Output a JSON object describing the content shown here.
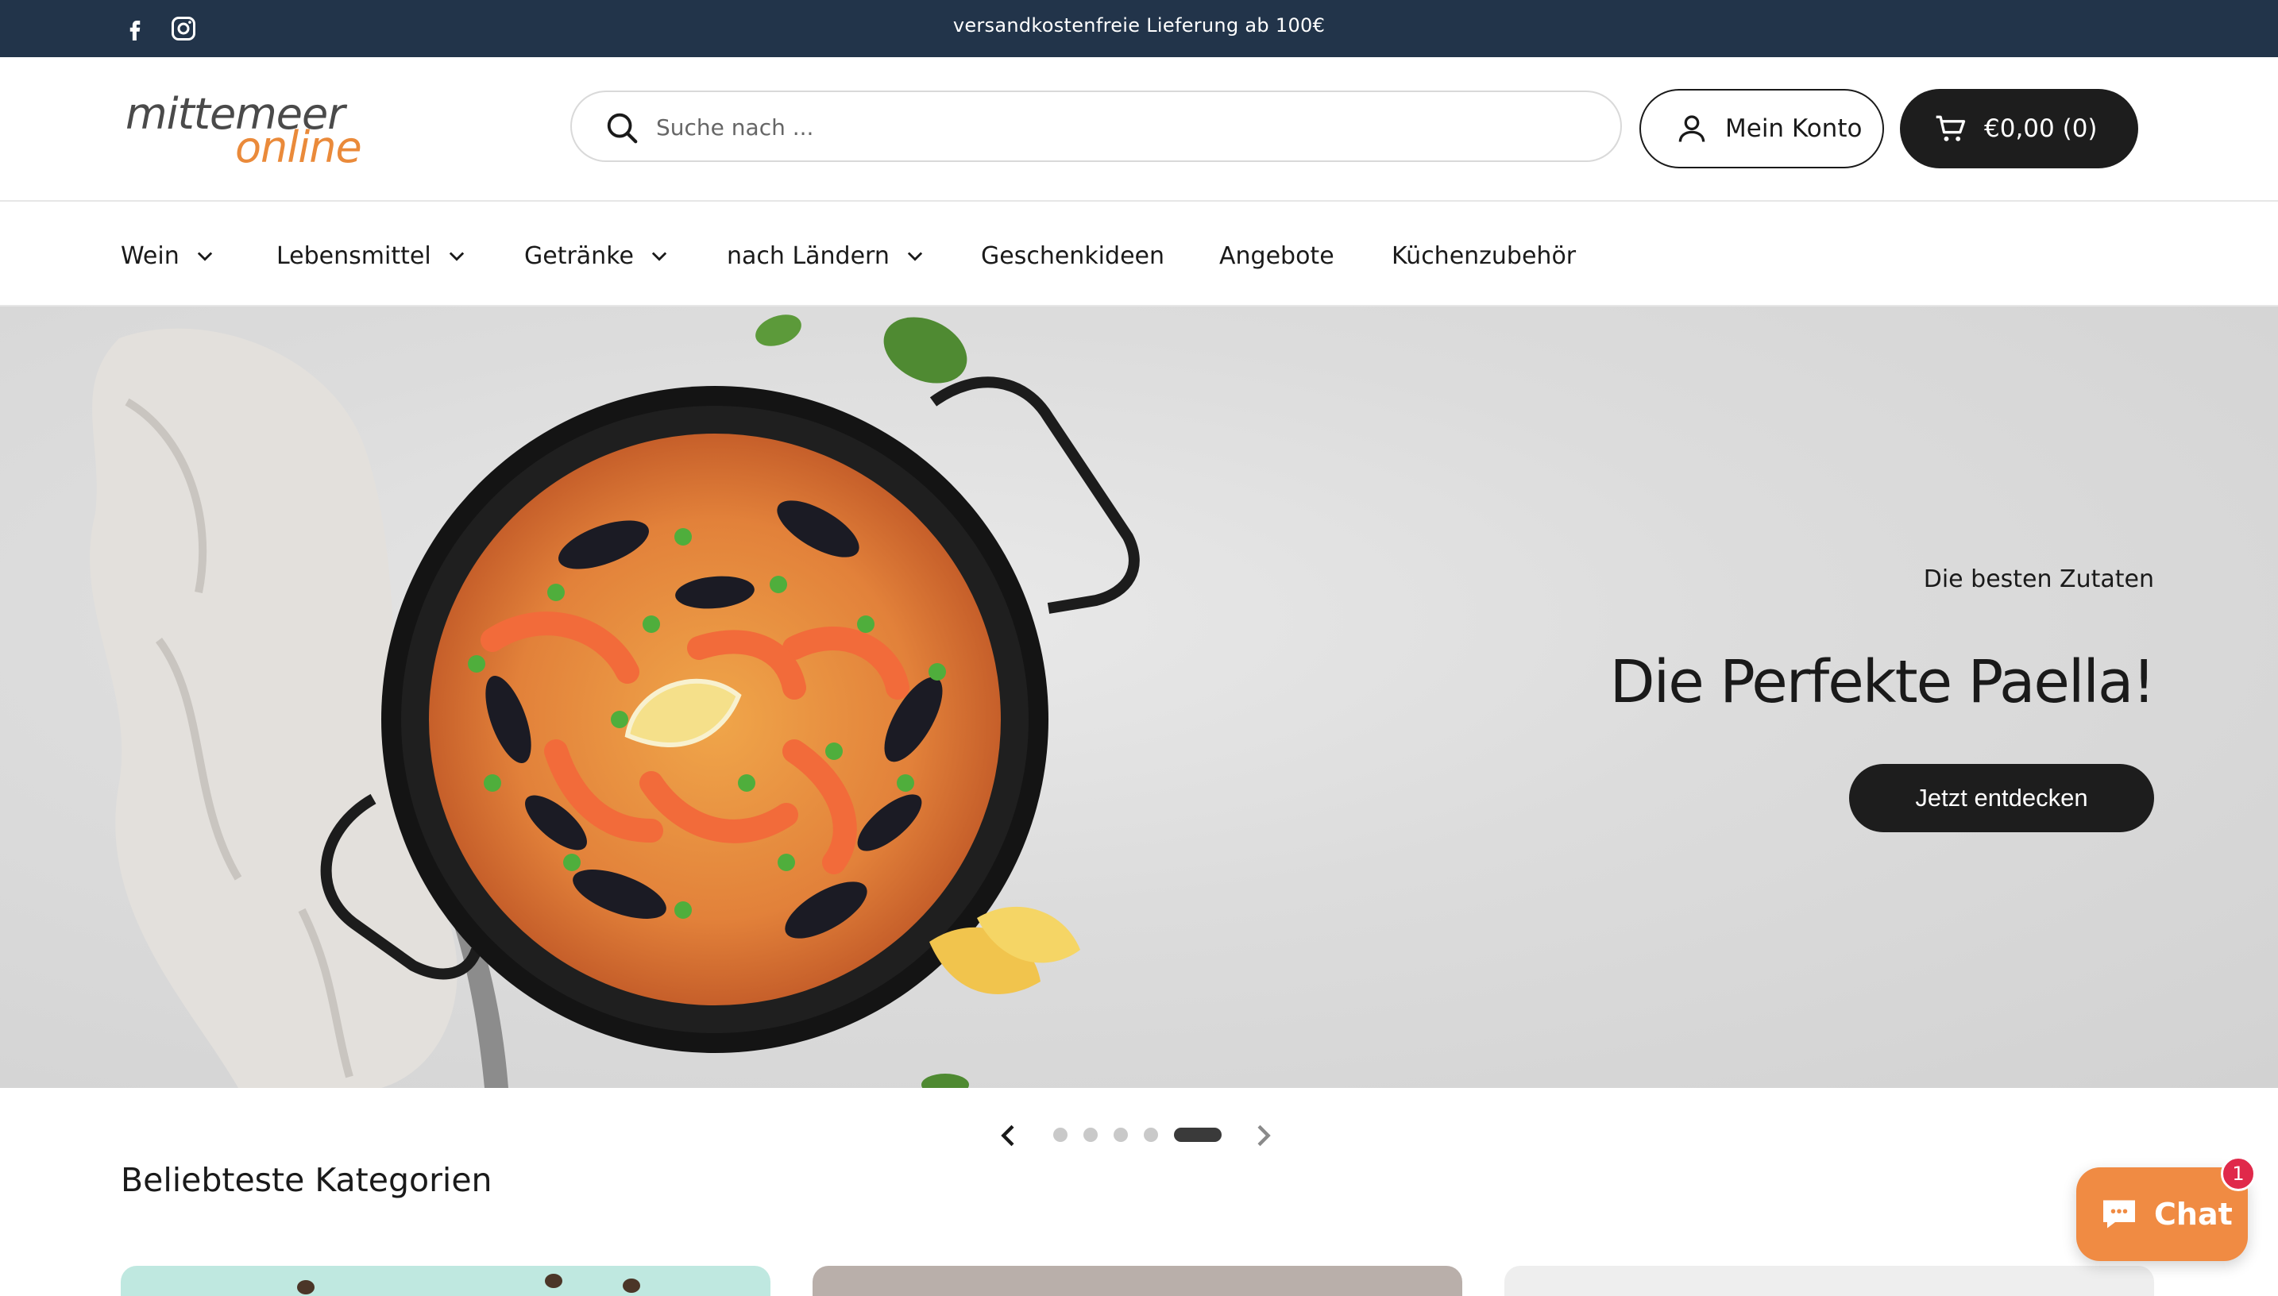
{
  "announcement": {
    "text": "versandkostenfreie Lieferung ab 100€"
  },
  "social": {
    "facebook_icon": "facebook-icon",
    "instagram_icon": "instagram-icon"
  },
  "logo": {
    "line1": "mittemeer",
    "line2": "online"
  },
  "search": {
    "placeholder": "Suche nach ..."
  },
  "account": {
    "label": "Mein Konto"
  },
  "cart": {
    "label": "€0,00 (0)"
  },
  "nav": {
    "items": [
      {
        "label": "Wein",
        "has_dropdown": true
      },
      {
        "label": "Lebensmittel",
        "has_dropdown": true
      },
      {
        "label": "Getränke",
        "has_dropdown": true
      },
      {
        "label": "nach Ländern",
        "has_dropdown": true
      },
      {
        "label": "Geschenkideen",
        "has_dropdown": false
      },
      {
        "label": "Angebote",
        "has_dropdown": false
      },
      {
        "label": "Küchenzubehör",
        "has_dropdown": false
      }
    ]
  },
  "hero": {
    "kicker": "Die besten Zutaten",
    "title": "Die Perfekte Paella!",
    "cta": "Jetzt entdecken"
  },
  "slider": {
    "slide_count": 5,
    "active_index": 4
  },
  "categories": {
    "title": "Beliebteste Kategorien"
  },
  "chat": {
    "label": "Chat",
    "badge": "1"
  },
  "colors": {
    "topbar": "#22344a",
    "logo_accent": "#ea8a3a",
    "button_dark": "#1d1d1d",
    "chat": "#f08b43",
    "badge": "#e0294a"
  }
}
